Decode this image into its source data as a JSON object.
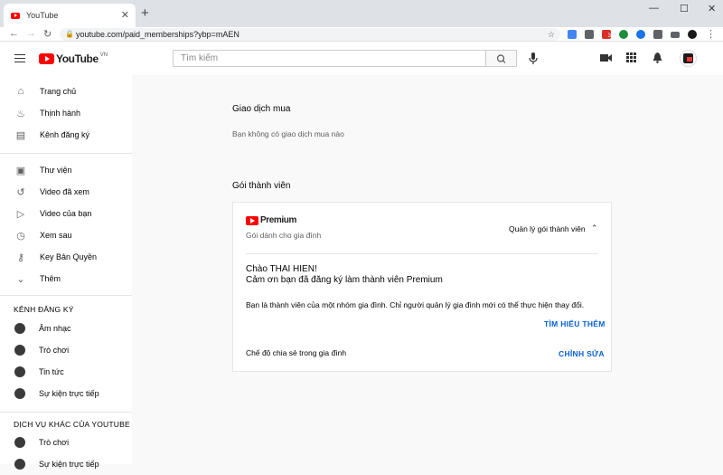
{
  "browser": {
    "tab_title": "YouTube",
    "close_glyph": "✕",
    "new_tab_glyph": "+",
    "url": "youtube.com/paid_memberships?ybp=mAEN",
    "window_controls": [
      "—",
      "☐",
      "✕"
    ],
    "ext_badge": "3"
  },
  "header": {
    "logo_word": "YouTube",
    "logo_region": "VN",
    "search_placeholder": "Tìm kiếm"
  },
  "sidebar": {
    "main_items": [
      {
        "label": "Trang chủ",
        "icon": "home-icon",
        "glyph": "⌂"
      },
      {
        "label": "Thịnh hành",
        "icon": "flame-icon",
        "glyph": "♨"
      },
      {
        "label": "Kênh đăng ký",
        "icon": "subscriptions-icon",
        "glyph": "▤"
      }
    ],
    "library_items": [
      {
        "label": "Thư viện",
        "icon": "library-icon",
        "glyph": "▣"
      },
      {
        "label": "Video đã xem",
        "icon": "history-icon",
        "glyph": "↺"
      },
      {
        "label": "Video của bạn",
        "icon": "your-videos-icon",
        "glyph": "▷"
      },
      {
        "label": "Xem sau",
        "icon": "clock-icon",
        "glyph": "◷"
      },
      {
        "label": "Key Bản Quyền",
        "icon": "key-icon",
        "glyph": "⚷"
      },
      {
        "label": "Thêm",
        "icon": "chevron-down-icon",
        "glyph": "⌄"
      }
    ],
    "subscriptions_heading": "KÊNH ĐĂNG KÝ",
    "subscriptions": [
      {
        "label": "Âm nhạc"
      },
      {
        "label": "Trò chơi"
      },
      {
        "label": "Tin tức"
      },
      {
        "label": "Sự kiện trực tiếp"
      }
    ],
    "more_heading": "DỊCH VỤ KHÁC CỦA YOUTUBE",
    "more_items": [
      {
        "label": "Trò chơi"
      },
      {
        "label": "Sự kiện trực tiếp"
      }
    ]
  },
  "main": {
    "purchases_title": "Giao dịch mua",
    "purchases_empty": "Bạn không có giao dịch mua nào",
    "memberships_title": "Gói thành viên",
    "card": {
      "logo_word": "Premium",
      "plan_subtitle": "Gói dành cho gia đình",
      "manage_label": "Quản lý gói thành viên",
      "chevron_glyph": "⌃",
      "greeting": "Chào THAI HIEN!",
      "thanks": "Cảm ơn bạn đã đăng ký làm thành viên Premium",
      "family_notice": "Bạn là thành viên của một nhóm gia đình. Chỉ người quản lý gia đình mới có thể thực hiện thay đổi.",
      "learn_more": "TÌM HIỂU THÊM",
      "sharing_label": "Chế độ chia sẻ trong gia đình",
      "edit_label": "CHỈNH SỬA"
    }
  },
  "colors": {
    "brand_red": "#ff0000",
    "link_blue": "#065fd4"
  }
}
